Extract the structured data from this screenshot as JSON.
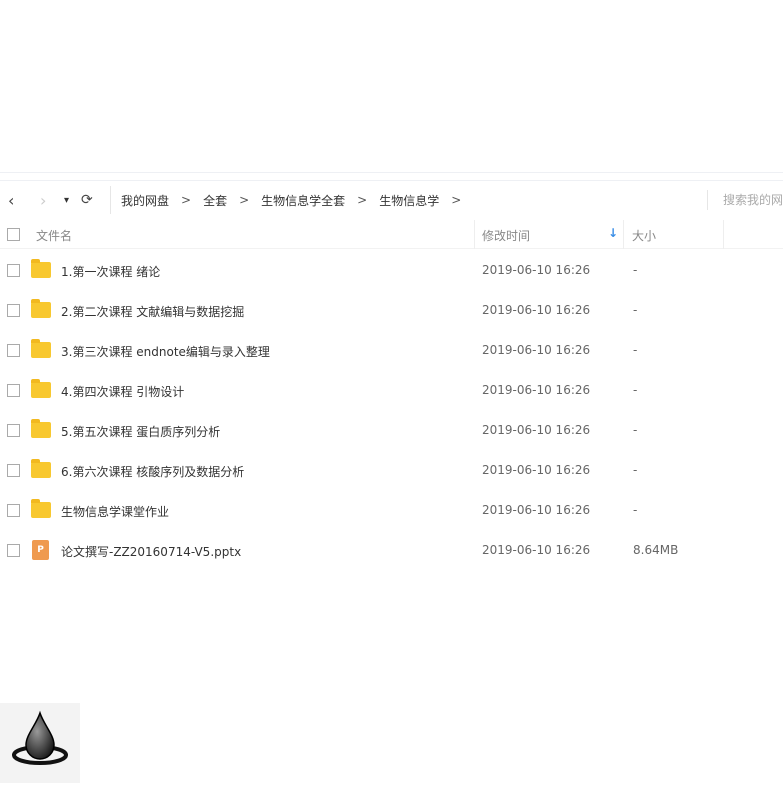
{
  "nav": {
    "back": "‹",
    "forward": "›",
    "dropdown": "▾",
    "refresh": "⟳"
  },
  "breadcrumb": [
    "我的网盘",
    "全套",
    "生物信息学全套",
    "生物信息学"
  ],
  "breadcrumb_sep": ">",
  "search_placeholder": "搜索我的网",
  "columns": {
    "name": "文件名",
    "modified": "修改时间",
    "size": "大小",
    "sort_icon": "↓"
  },
  "files": [
    {
      "name": "1.第一次课程 绪论",
      "modified": "2019-06-10 16:26",
      "size": "-",
      "type": "folder"
    },
    {
      "name": "2.第二次课程 文献编辑与数据挖掘",
      "modified": "2019-06-10 16:26",
      "size": "-",
      "type": "folder"
    },
    {
      "name": "3.第三次课程 endnote编辑与录入整理",
      "modified": "2019-06-10 16:26",
      "size": "-",
      "type": "folder"
    },
    {
      "name": "4.第四次课程 引物设计",
      "modified": "2019-06-10 16:26",
      "size": "-",
      "type": "folder"
    },
    {
      "name": "5.第五次课程 蛋白质序列分析",
      "modified": "2019-06-10 16:26",
      "size": "-",
      "type": "folder"
    },
    {
      "name": "6.第六次课程 核酸序列及数据分析",
      "modified": "2019-06-10 16:26",
      "size": "-",
      "type": "folder"
    },
    {
      "name": "生物信息学课堂作业",
      "modified": "2019-06-10 16:26",
      "size": "-",
      "type": "folder"
    },
    {
      "name": "论文撰写-ZZ20160714-V5.pptx",
      "modified": "2019-06-10 16:26",
      "size": "8.64MB",
      "type": "pptx"
    }
  ],
  "ppt_icon_letter": "P"
}
